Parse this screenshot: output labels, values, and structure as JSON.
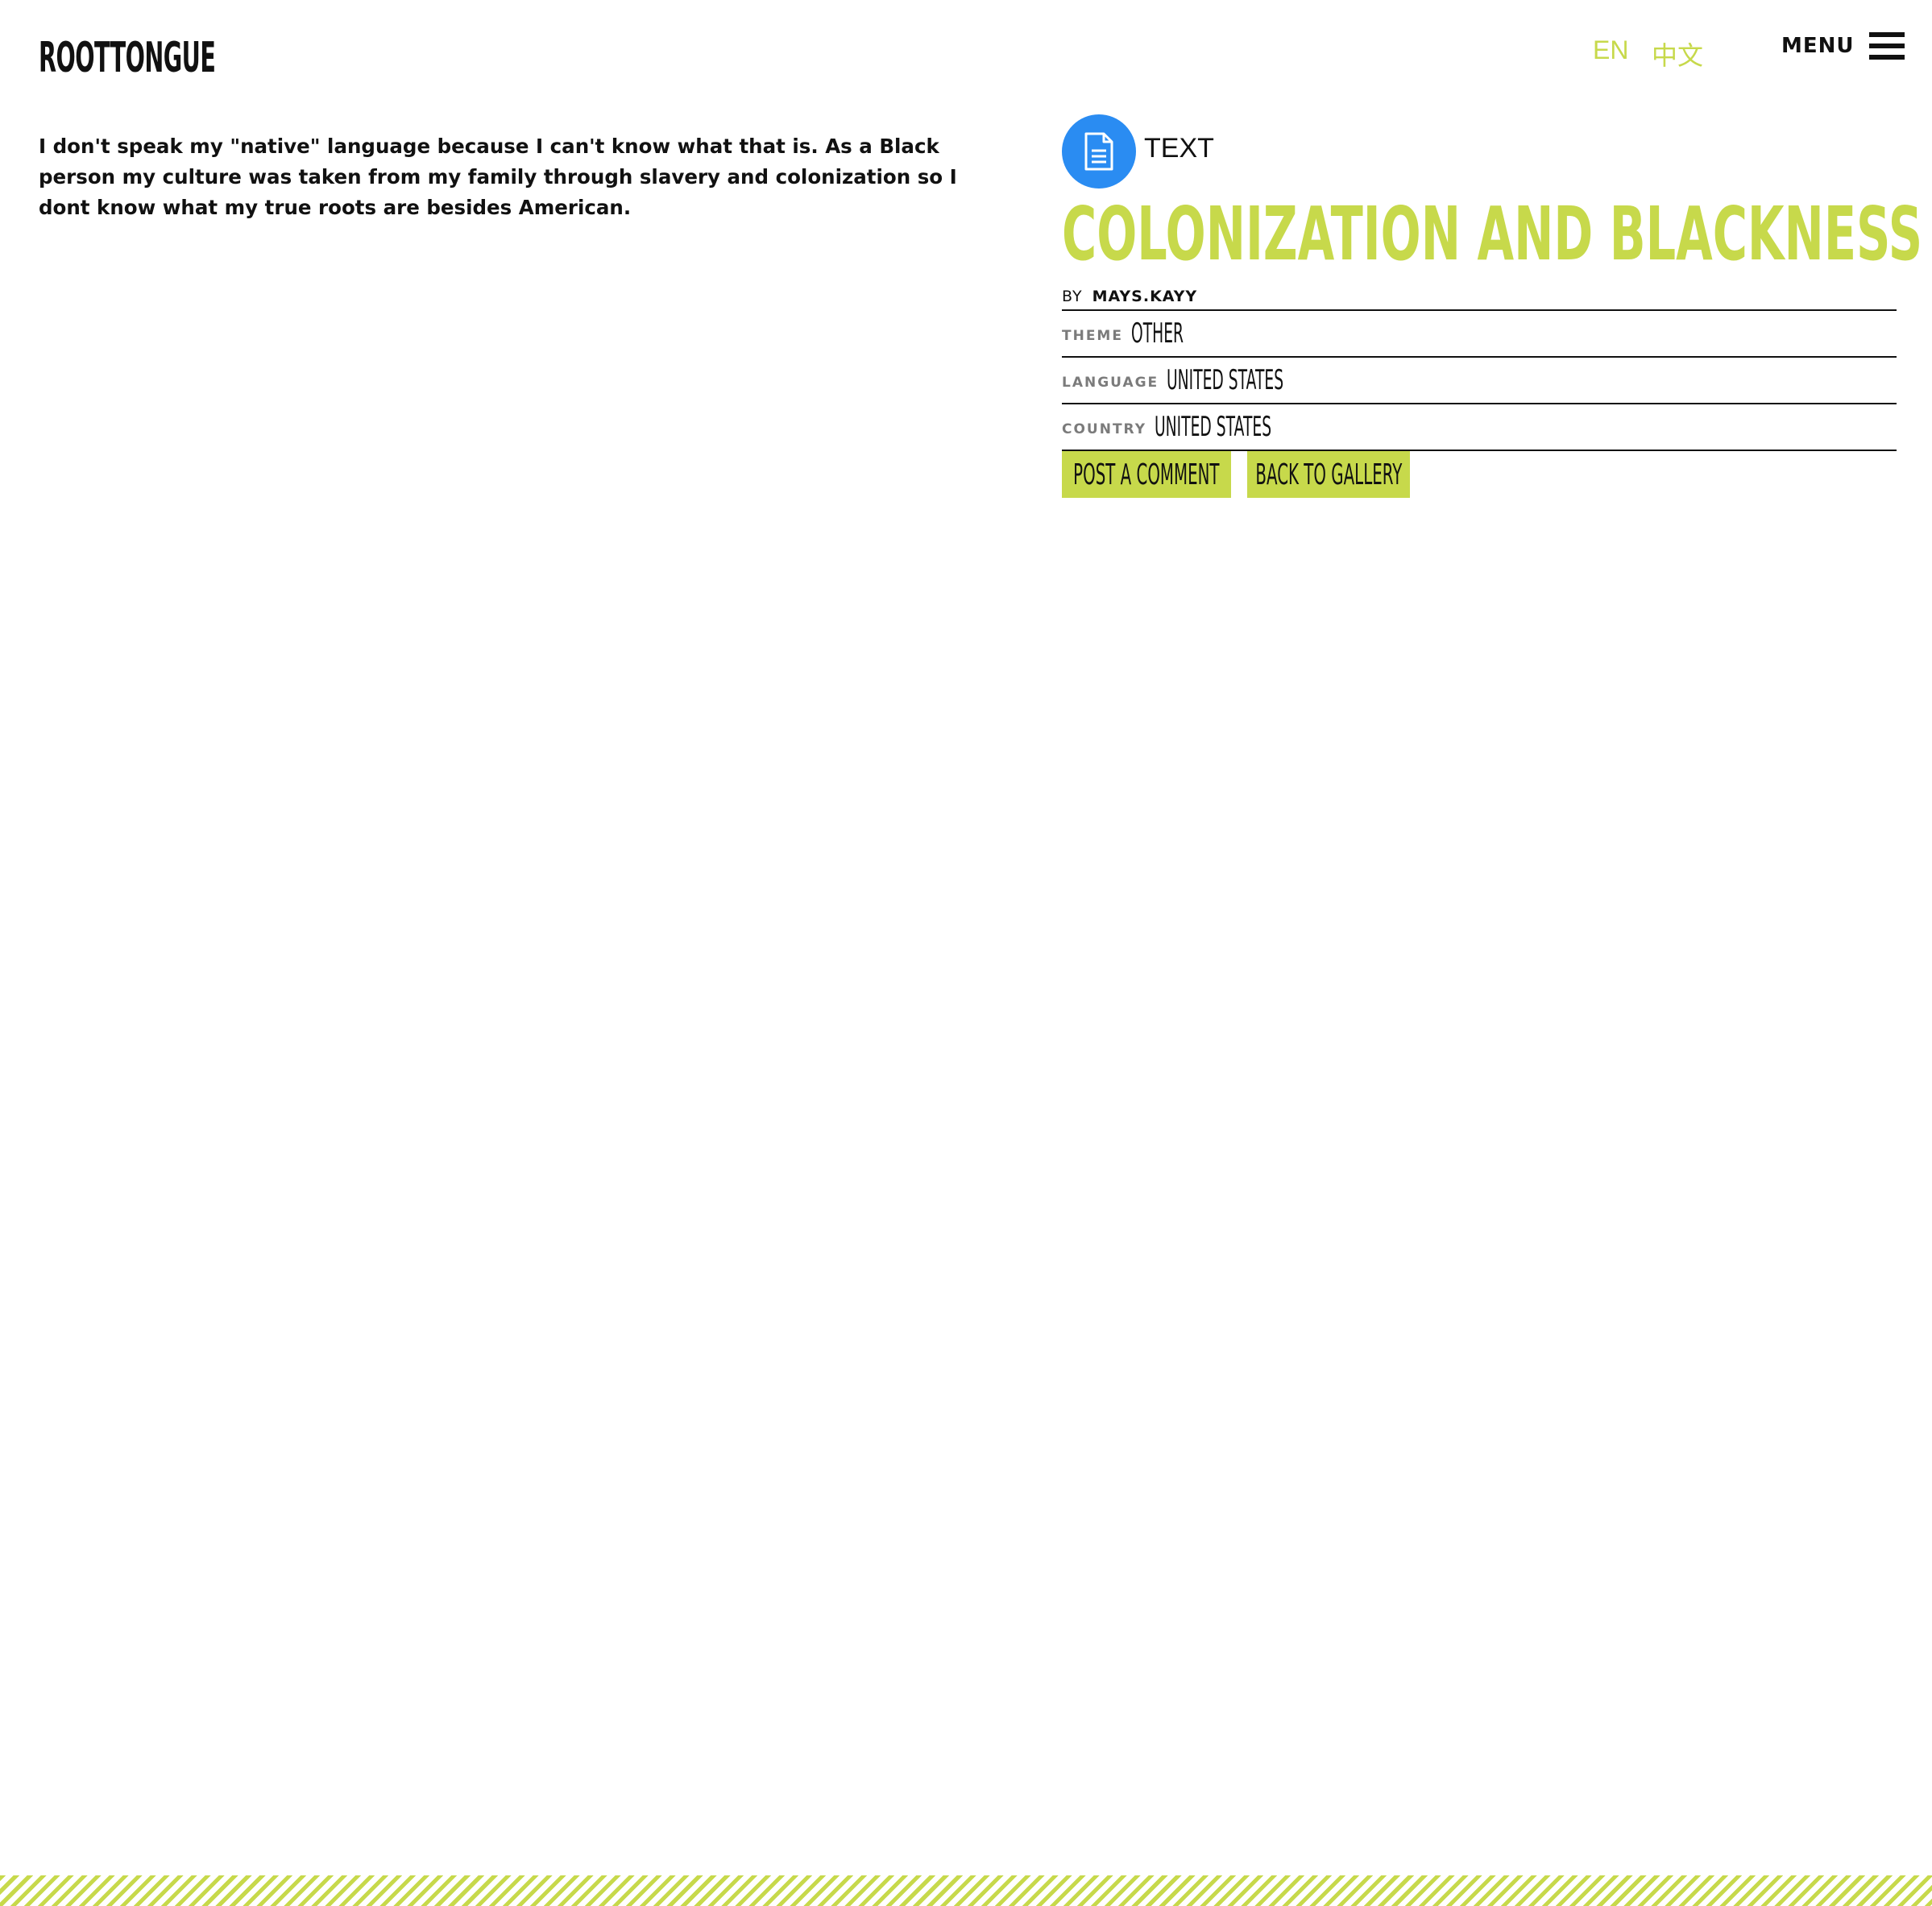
{
  "header": {
    "logo_text": "ROOTTONGUE",
    "lang_en": "EN",
    "lang_zh": "中文",
    "menu_label": "MENU"
  },
  "submission": {
    "body": "I don't speak my \"native\" language because I can't know what that is. As a Black person my culture was taken from my family through slavery and colonization so I dont know what my true roots are besides American.",
    "type_label": "TEXT",
    "type_icon": "document-icon",
    "title": "COLONIZATION AND BLACKNESS",
    "by_label": "BY",
    "author": "MAYS.KAYY",
    "meta": [
      {
        "key": "THEME",
        "value": "OTHER"
      },
      {
        "key": "LANGUAGE",
        "value": "UNITED STATES"
      },
      {
        "key": "COUNTRY",
        "value": "UNITED STATES"
      }
    ]
  },
  "actions": {
    "post_comment": "POST A COMMENT",
    "back_to_gallery": "BACK TO GALLERY"
  },
  "colors": {
    "accent": "#c7d94b",
    "icon_blue": "#2a8cf2",
    "text": "#111111",
    "muted": "#7b7b7b"
  }
}
